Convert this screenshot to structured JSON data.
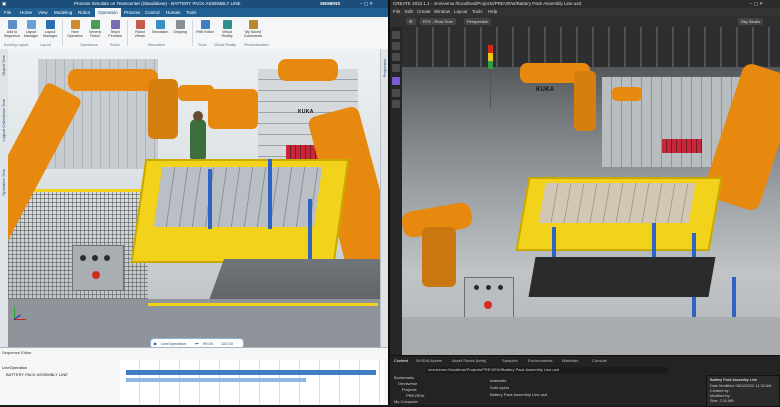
{
  "left_window": {
    "title": "Process Simulate on Teamcenter (Standalone) - BATTERY PACK ASSEMBLY LINE",
    "brand": "SIEMENS",
    "tabs": [
      "File",
      "Home",
      "View",
      "Modeling",
      "Robot",
      "Operation",
      "Process",
      "Control",
      "Human",
      "Tools"
    ],
    "active_tab": "Operation",
    "ribbon_buttons": [
      {
        "label": "Add to Sequence",
        "color": "#5a8fc7"
      },
      {
        "label": "Layout Manager",
        "color": "#6aa0d4"
      },
      {
        "label": "Layout Manager",
        "color": "#2b6fb3"
      },
      {
        "label": "New Operation",
        "color": "#d08a2c"
      },
      {
        "label": "Generic Robot",
        "color": "#4a9a5b"
      },
      {
        "label": "Teach Pendant",
        "color": "#7c6bb0"
      },
      {
        "label": "Robot Viewer",
        "color": "#c75b4a"
      },
      {
        "label": "Simulation",
        "color": "#3a8fc2"
      },
      {
        "label": "Gripping",
        "color": "#8a8f96"
      },
      {
        "label": "Path Editor",
        "color": "#3d7fc1"
      },
      {
        "label": "Virtual Reality",
        "color": "#2f8e8e"
      },
      {
        "label": "My Saved Commands",
        "color": "#b7892f"
      }
    ],
    "ribbon_groups": [
      "Existing Layout",
      "Layout",
      "Operations",
      "Robot",
      "Simulation",
      "Tools",
      "Virtual Reality",
      "Personalization"
    ],
    "sidebar_labels": [
      "Object Tree",
      "Logical Collections Tree",
      "Operation Tree"
    ],
    "right_sidebar_label": "Properties",
    "sim_controls_label": "LineOperation",
    "sim_time": "99.00",
    "sim_time_end": "110.00",
    "sequence_editor": {
      "title": "Sequence Editor",
      "rows": [
        "LineOperation",
        "BATTERY PACK ASSEMBLY LINE"
      ],
      "time_marks": [
        "0",
        "20",
        "40",
        "60",
        "80",
        "100",
        "120",
        "140",
        "160",
        "180",
        "200",
        "220",
        "240"
      ]
    }
  },
  "right_window": {
    "title": "CREATE 2022.1.1 - omniverse://localhost/Projects/PREVIEW/Battery Pack Assembly Line.usd",
    "menu": [
      "File",
      "Edit",
      "Create",
      "Window",
      "Layout",
      "Tools",
      "Help"
    ],
    "toolbar": {
      "render_mode": "RTX - Real-Time",
      "camera": "Perspective",
      "fps_label": "Sky Studio"
    },
    "bottom_tabs": [
      "Content",
      "NVIDIA Assets",
      "Asset Stores (beta)",
      "Samples",
      "Environments",
      "Materials",
      "Console"
    ],
    "active_bottom_tab": "Content",
    "path": "omniverse://localhost/Projects/PREVIEW/Battery Pack Assembly Line.usd",
    "tree": [
      "Bookmarks",
      "Omniverse",
      "Projects",
      "PREVIEW",
      "My Computer"
    ],
    "files": [
      "materials",
      "SubLayers",
      "Battery Pack Assembly Line.usd"
    ],
    "properties": {
      "title": "Battery Pack Assembly Line",
      "date": "Date Modified: 08/12/2022 11:32 AM",
      "created_by": "Created by:",
      "modified_by": "Modified by:",
      "size": "Size: 2.04 MB"
    }
  },
  "scene": {
    "robot_brand": "KUKA",
    "colors": {
      "robot_orange": "#e8890f",
      "fixture_yellow": "#f2d21b",
      "frame_blue": "#2f63c4",
      "floor_gray": "#9aa0a4"
    }
  }
}
